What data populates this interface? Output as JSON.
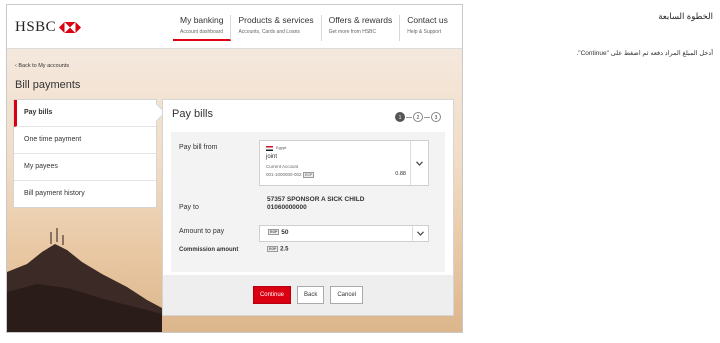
{
  "instructions": {
    "title": "الخطوة السابعة",
    "text": "أدخل المبلغ المراد دفعه ثم اضغط على \"Continue\"."
  },
  "header": {
    "logo_text": "HSBC",
    "nav": [
      {
        "title": "My banking",
        "subtitle": "Account dashboard"
      },
      {
        "title": "Products & services",
        "subtitle": "Accounts, Cards and Loans"
      },
      {
        "title": "Offers & rewards",
        "subtitle": "Get more from HSBC"
      },
      {
        "title": "Contact us",
        "subtitle": "Help & Support"
      }
    ]
  },
  "back_link": "‹ Back to My accounts",
  "page_title": "Bill payments",
  "sidebar": {
    "items": [
      {
        "label": "Pay bills"
      },
      {
        "label": "One time payment"
      },
      {
        "label": "My payees"
      },
      {
        "label": "Bill payment history"
      }
    ]
  },
  "panel": {
    "title": "Pay bills",
    "steps": [
      "1",
      "2",
      "3"
    ],
    "pay_from_label": "Pay bill from",
    "account": {
      "country": "Egypt",
      "name": "joint",
      "type": "Current Account",
      "number": "001-1000000-002",
      "currency": "EGP",
      "balance": "0.88"
    },
    "pay_to_label": "Pay to",
    "payee_name": "57357 SPONSOR A SICK CHILD",
    "payee_number": "01060000000",
    "amount_label": "Amount to pay",
    "amount_currency": "EGP",
    "amount_value": "50",
    "commission_label": "Commission amount",
    "commission_currency": "EGP",
    "commission_value": "2.5",
    "buttons": {
      "continue": "Continue",
      "back": "Back",
      "cancel": "Cancel"
    }
  },
  "colors": {
    "brand_red": "#db0011"
  }
}
